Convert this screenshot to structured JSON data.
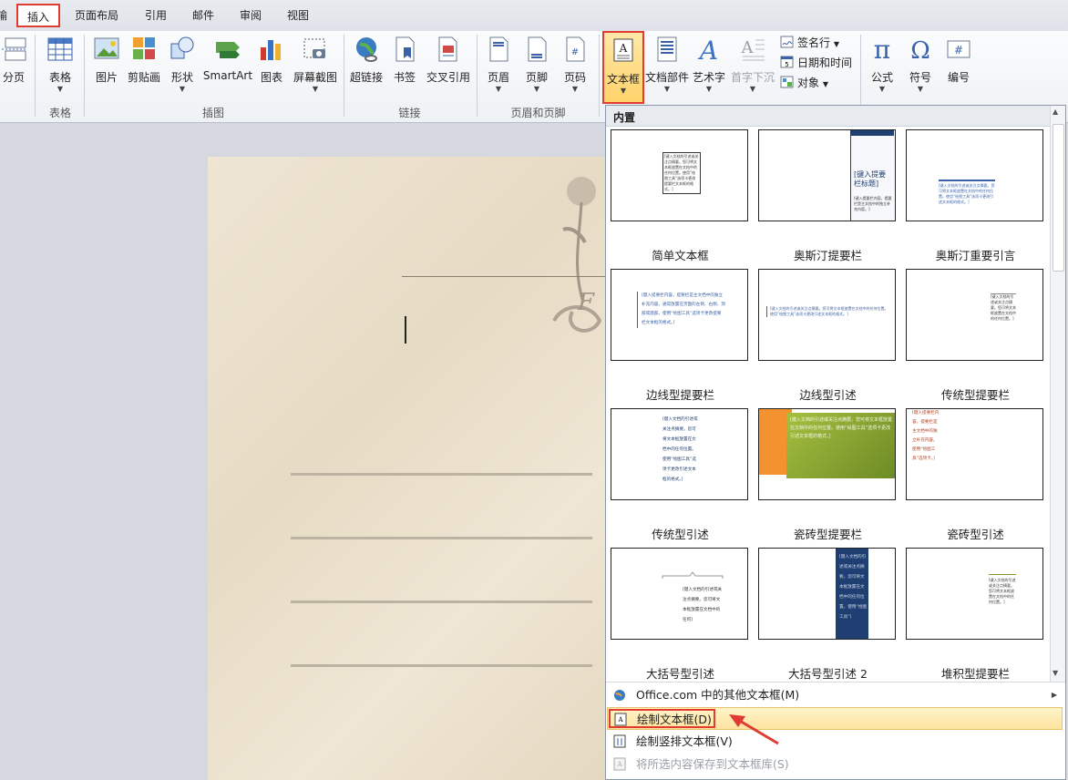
{
  "tabs": {
    "partial": "输",
    "insert": "插入",
    "page_layout": "页面布局",
    "references": "引用",
    "mailings": "邮件",
    "review": "审阅",
    "view": "视图"
  },
  "ribbon": {
    "page_break": "分页",
    "table": "表格",
    "picture": "图片",
    "clipart": "剪贴画",
    "shapes": "形状",
    "smartart": "SmartArt",
    "chart": "图表",
    "screenshot": "屏幕截图",
    "hyperlink": "超链接",
    "bookmark": "书签",
    "crossref": "交叉引用",
    "header": "页眉",
    "footer": "页脚",
    "page_number": "页码",
    "textbox": "文本框",
    "quickparts": "文档部件",
    "wordart": "艺术字",
    "dropcap": "首字下沉",
    "signature": "签名行",
    "datetime": "日期和时间",
    "object": "对象",
    "equation": "公式",
    "symbol": "符号",
    "number": "编号",
    "group_tables": "表格",
    "group_illustrations": "插图",
    "group_links": "链接",
    "group_header_footer": "页眉和页脚"
  },
  "dropdown": {
    "section": "内置",
    "items": [
      {
        "label": "简单文本框"
      },
      {
        "label": "奥斯汀提要栏"
      },
      {
        "label": "奥斯汀重要引言"
      },
      {
        "label": "边线型提要栏"
      },
      {
        "label": "边线型引述"
      },
      {
        "label": "传统型提要栏"
      },
      {
        "label": "传统型引述"
      },
      {
        "label": "瓷砖型提要栏"
      },
      {
        "label": "瓷砖型引述"
      },
      {
        "label": "大括号型引述"
      },
      {
        "label": "大括号型引述 2"
      },
      {
        "label": "堆积型提要栏"
      }
    ],
    "thumb_text": {
      "t1": "[键入文档的引述或关注点摘要。您可将文本框放置在文档中的任何位置。使用“绘图工具”选项卡更改提要栏文本框的格式。]",
      "t2_title": "[键入提要栏标题]",
      "t2_body": "[键入提要栏内容。提要栏是主文档中的独立补充内容。]",
      "t3": "[键入文档的引述或关注点摘要。您可将文本框放置在文档中的任何位置。使用“绘图工具”选项卡更改引述文本框的格式。]",
      "t4": "[键入提要栏内容。提要栏是主文档中的独立补充内容。通常放置在页面的左侧、右侧、顶部或底部。使用“绘图工具”选项卡更改提要栏文本框的格式。]",
      "t5": "[键入文档的引述或关注点摘要。您可将文本框放置在文档中的任何位置。使用“绘图工具”选项卡更改引述文本框的格式。]",
      "t6": "[键入文档的引述或关注点摘要。您可将文本框放置在文档中的任何位置。]",
      "t7": "[键入文档的引述或关注点摘要。您可将文本框放置在文档中的任何位置。使用“绘图工具”选项卡更改引述文本框的格式。]",
      "t8": "[键入文档的引述或关注点摘要。您可将文本框放置在文档中的任何位置。使用“绘图工具”选项卡更改引述文本框的格式。]",
      "t9": "[键入提要栏内容。提要栏是主文档中的独立补充内容。使用“绘图工具”选项卡。]",
      "t10": "[键入文档的引述或关注点摘要。您可将文本框放置在文档中的任何]",
      "t11": "[键入文档的引述或关注点摘要。您可将文本框放置在文档中的任何位置。使用“绘图工具”]",
      "t12": "[键入文档的引述或关注点摘要。您可将文本框放置在文档中的任何位置。]"
    },
    "menu": {
      "more": "Office.com 中的其他文本框(M)",
      "draw": "绘制文本框(D)",
      "draw_vertical": "绘制竖排文本框(V)",
      "save": "将所选内容保存到文本框库(S)"
    }
  },
  "colors": {
    "highlight": "#e03c31",
    "menu_hover": "#fde9a8",
    "orange": "#f3922f",
    "green": "#7d9a2b",
    "navy": "#1f3f73"
  }
}
